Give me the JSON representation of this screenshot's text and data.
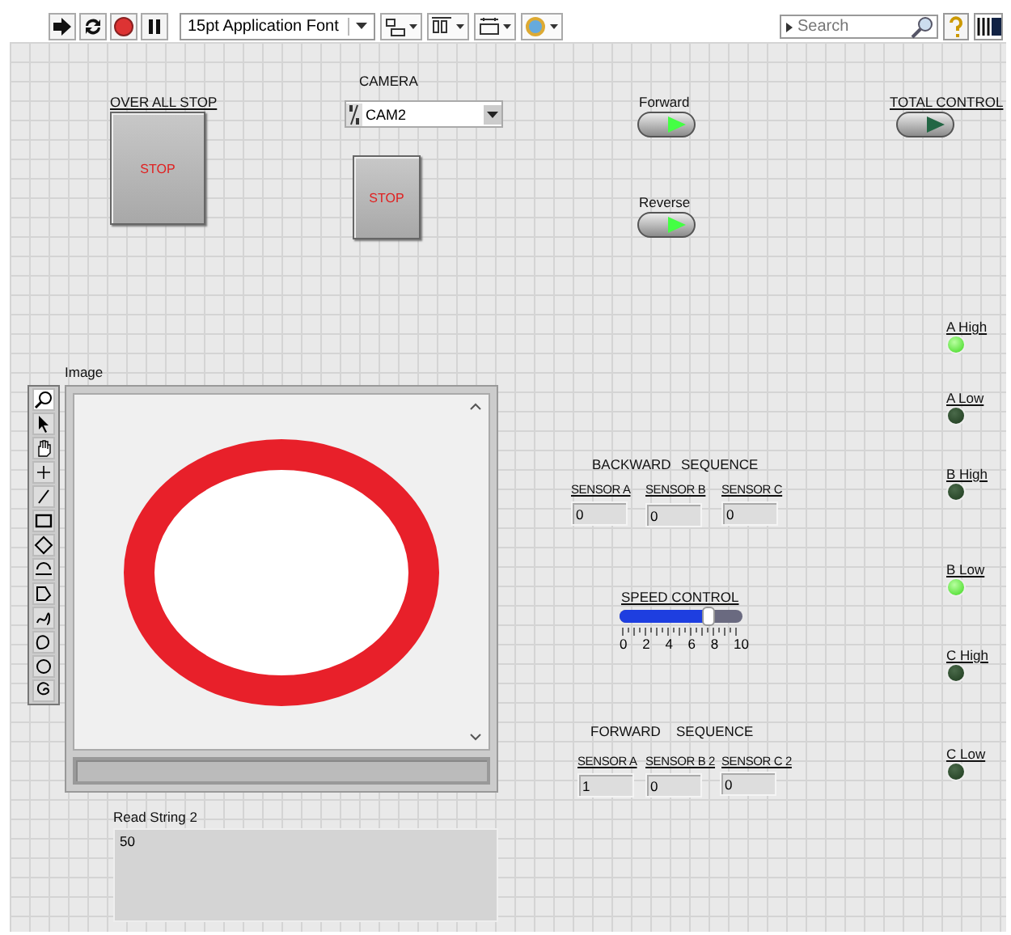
{
  "toolbar": {
    "font": "15pt Application Font",
    "search": {
      "placeholder": "Search"
    }
  },
  "overall_stop": {
    "label": "OVER ALL STOP",
    "button": "STOP"
  },
  "camera": {
    "label": "CAMERA",
    "value": "CAM2"
  },
  "camera_stop": {
    "button": "STOP"
  },
  "switches": [
    {
      "label": "Forward",
      "on": true,
      "underlined": false
    },
    {
      "label": "Reverse",
      "on": true,
      "underlined": false
    },
    {
      "label": "TOTAL CONTROL",
      "on": false,
      "underlined": true
    }
  ],
  "image_display": {
    "label": "Image"
  },
  "read_string": {
    "label": "Read String 2",
    "value": "50"
  },
  "backward_sequence": {
    "titles": [
      "BACKWARD",
      "SEQUENCE"
    ],
    "sensors": [
      {
        "label": "SENSOR  A",
        "value": "0"
      },
      {
        "label": "SENSOR B",
        "value": "0"
      },
      {
        "label": "SENSOR C",
        "value": "0"
      }
    ]
  },
  "speed_control": {
    "label": "SPEED CONTROL",
    "level": 0.72,
    "scale": [
      "0",
      "2",
      "4",
      "6",
      "8",
      "10"
    ]
  },
  "forward_sequence": {
    "titles": [
      "FORWARD",
      "SEQUENCE"
    ],
    "sensors": [
      {
        "label": "SENSOR  A",
        "value": "1"
      },
      {
        "label": "SENSOR B 2",
        "value": "0"
      },
      {
        "label": "SENSOR C 2",
        "value": "0"
      }
    ]
  },
  "leds": [
    {
      "label": "A High",
      "on": true
    },
    {
      "label": "A Low",
      "on": false
    },
    {
      "label": "B High",
      "on": false
    },
    {
      "label": "B Low",
      "on": true
    },
    {
      "label": "C High",
      "on": false
    },
    {
      "label": "C Low",
      "on": false
    }
  ]
}
